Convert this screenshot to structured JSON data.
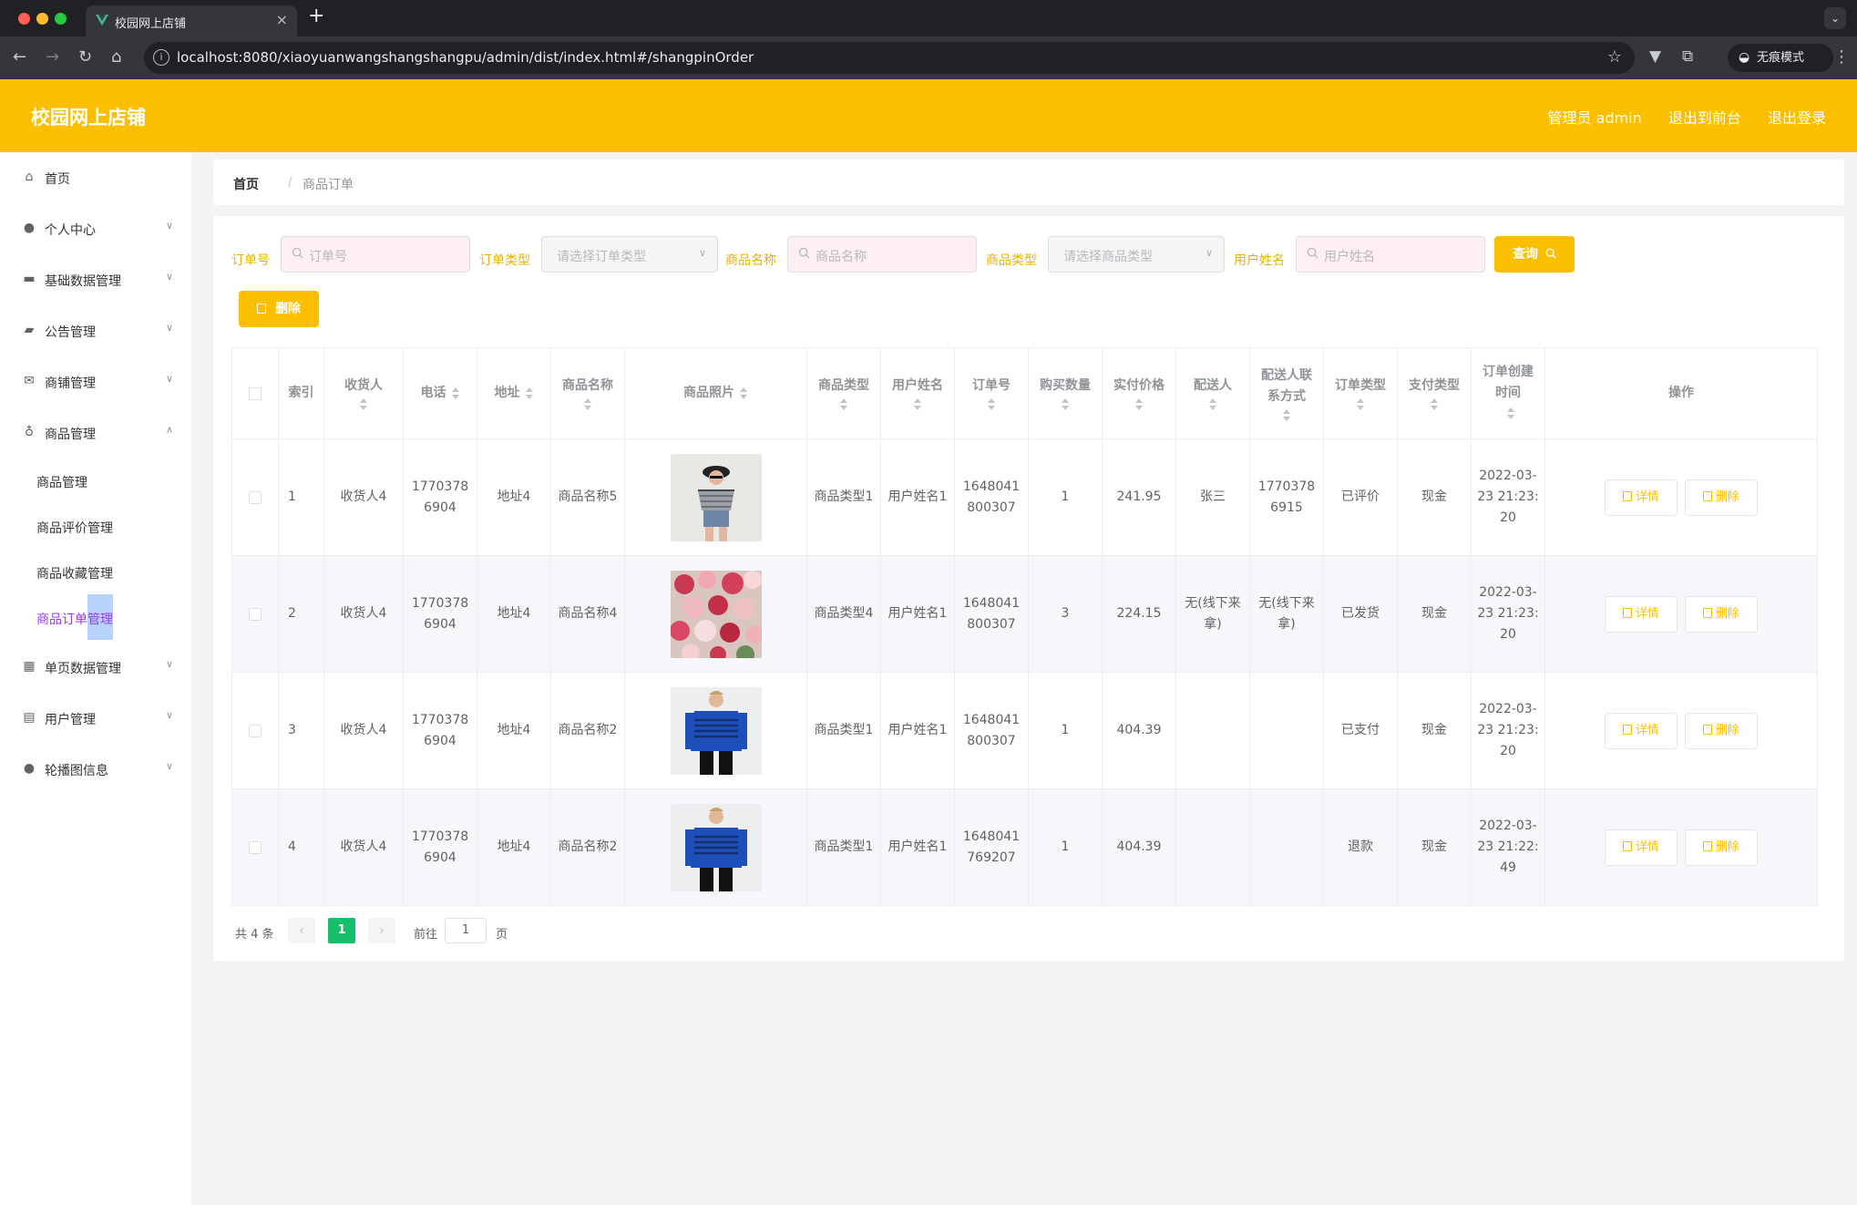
{
  "browser": {
    "tab_title": "校园网上店铺",
    "url": "localhost:8080/xiaoyuanwangshangshangpu/admin/dist/index.html#/shangpinOrder",
    "incognito_label": "无痕模式"
  },
  "header": {
    "title": "校园网上店铺",
    "user": "管理员 admin",
    "front_link": "退出到前台",
    "logout_link": "退出登录"
  },
  "sidebar": {
    "items": [
      {
        "label": "首页",
        "icon": "home-icon"
      },
      {
        "label": "个人中心",
        "icon": "user-icon"
      },
      {
        "label": "基础数据管理",
        "icon": "monitor-icon"
      },
      {
        "label": "公告管理",
        "icon": "notice-icon"
      },
      {
        "label": "商铺管理",
        "icon": "mail-icon"
      },
      {
        "label": "商品管理",
        "icon": "mic-icon"
      },
      {
        "label": "单页数据管理",
        "icon": "grid-icon"
      },
      {
        "label": "用户管理",
        "icon": "clipboard-icon"
      },
      {
        "label": "轮播图信息",
        "icon": "user-icon"
      }
    ],
    "sub_items": [
      "商品管理",
      "商品评价管理",
      "商品收藏管理",
      "商品订单管理"
    ]
  },
  "breadcrumb": {
    "home": "首页",
    "sep": "/",
    "current": "商品订单"
  },
  "filters": {
    "order_no_label": "订单号",
    "order_no_placeholder": "订单号",
    "order_type_label": "订单类型",
    "order_type_placeholder": "请选择订单类型",
    "product_name_label": "商品名称",
    "product_name_placeholder": "商品名称",
    "product_type_label": "商品类型",
    "product_type_placeholder": "请选择商品类型",
    "user_name_label": "用户姓名",
    "user_name_placeholder": "用户姓名",
    "query_button": "查询",
    "delete_button": "删除"
  },
  "table": {
    "headers": [
      "索引",
      "收货人",
      "电话",
      "地址",
      "商品名称",
      "商品照片",
      "商品类型",
      "用户姓名",
      "订单号",
      "购买数量",
      "实付价格",
      "配送人",
      "配送人联系方式",
      "订单类型",
      "支付类型",
      "订单创建时间",
      "操作"
    ],
    "rows": [
      {
        "index": "1",
        "receiver": "收货人4",
        "phone": "17703786904",
        "address": "地址4",
        "product_name": "商品名称5",
        "photo": "woman-striped-top",
        "product_type": "商品类型1",
        "user_name": "用户姓名1",
        "order_no": "1648041800307",
        "qty": "1",
        "price": "241.95",
        "courier": "张三",
        "courier_phone": "17703786915",
        "order_type": "已评价",
        "pay_type": "现金",
        "created": "2022-03-23 21:23:20"
      },
      {
        "index": "2",
        "receiver": "收货人4",
        "phone": "17703786904",
        "address": "地址4",
        "product_name": "商品名称4",
        "photo": "roses",
        "product_type": "商品类型4",
        "user_name": "用户姓名1",
        "order_no": "1648041800307",
        "qty": "3",
        "price": "224.15",
        "courier": "无(线下来拿)",
        "courier_phone": "无(线下来拿)",
        "order_type": "已发货",
        "pay_type": "现金",
        "created": "2022-03-23 21:23:20"
      },
      {
        "index": "3",
        "receiver": "收货人4",
        "phone": "17703786904",
        "address": "地址4",
        "product_name": "商品名称2",
        "photo": "man-blue-sweater",
        "product_type": "商品类型1",
        "user_name": "用户姓名1",
        "order_no": "1648041800307",
        "qty": "1",
        "price": "404.39",
        "courier": "",
        "courier_phone": "",
        "order_type": "已支付",
        "pay_type": "现金",
        "created": "2022-03-23 21:23:20"
      },
      {
        "index": "4",
        "receiver": "收货人4",
        "phone": "17703786904",
        "address": "地址4",
        "product_name": "商品名称2",
        "photo": "man-blue-sweater",
        "product_type": "商品类型1",
        "user_name": "用户姓名1",
        "order_no": "1648041769207",
        "qty": "1",
        "price": "404.39",
        "courier": "",
        "courier_phone": "",
        "order_type": "退款",
        "pay_type": "现金",
        "created": "2022-03-23 21:22:49"
      }
    ],
    "detail_button": "详情",
    "delete_button": "删除"
  },
  "pagination": {
    "total": "共 4 条",
    "current_page": "1",
    "goto_label": "前往",
    "goto_value": "1",
    "page_unit": "页"
  },
  "colors": {
    "accent": "#fcbf00",
    "active_menu": "#9a3aec",
    "page_current": "#19be6b"
  }
}
